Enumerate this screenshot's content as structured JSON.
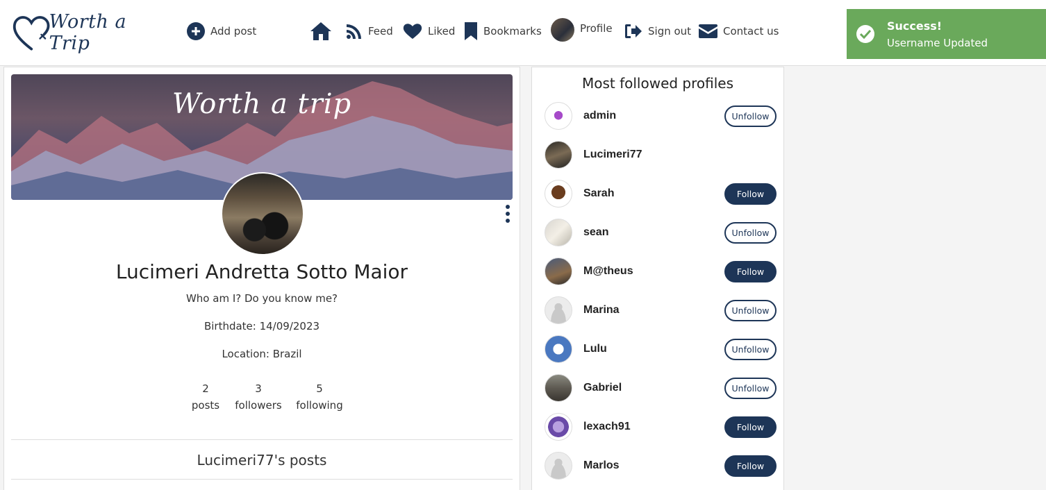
{
  "brand": {
    "logo_text": "Worth a Trip",
    "accent_color": "#1d3557"
  },
  "nav": {
    "add_post": "Add post",
    "feed": "Feed",
    "liked": "Liked",
    "bookmarks": "Bookmarks",
    "profile": "Profile",
    "sign_out": "Sign out",
    "contact": "Contact us"
  },
  "toast": {
    "title": "Success!",
    "message": "Username Updated",
    "color": "#6aa95b"
  },
  "profile": {
    "banner_text": "Worth a trip",
    "full_name": "Lucimeri Andretta Sotto Maior",
    "bio": "Who am I? Do you know me?",
    "birthdate": "Birthdate: 14/09/2023",
    "location": "Location: Brazil",
    "stats": {
      "posts_count": "2",
      "posts_label": "posts",
      "followers_count": "3",
      "followers_label": "followers",
      "following_count": "5",
      "following_label": "following"
    },
    "posts_heading": "Lucimeri77's posts"
  },
  "sidebar": {
    "title": "Most followed profiles",
    "profiles": [
      {
        "name": "admin",
        "button": "Unfollow"
      },
      {
        "name": "Lucimeri77",
        "button": ""
      },
      {
        "name": "Sarah",
        "button": "Follow"
      },
      {
        "name": "sean",
        "button": "Unfollow"
      },
      {
        "name": "M@theus",
        "button": "Follow"
      },
      {
        "name": "Marina",
        "button": "Unfollow"
      },
      {
        "name": "Lulu",
        "button": "Unfollow"
      },
      {
        "name": "Gabriel",
        "button": "Unfollow"
      },
      {
        "name": "lexach91",
        "button": "Follow"
      },
      {
        "name": "Marlos",
        "button": "Follow"
      }
    ]
  }
}
